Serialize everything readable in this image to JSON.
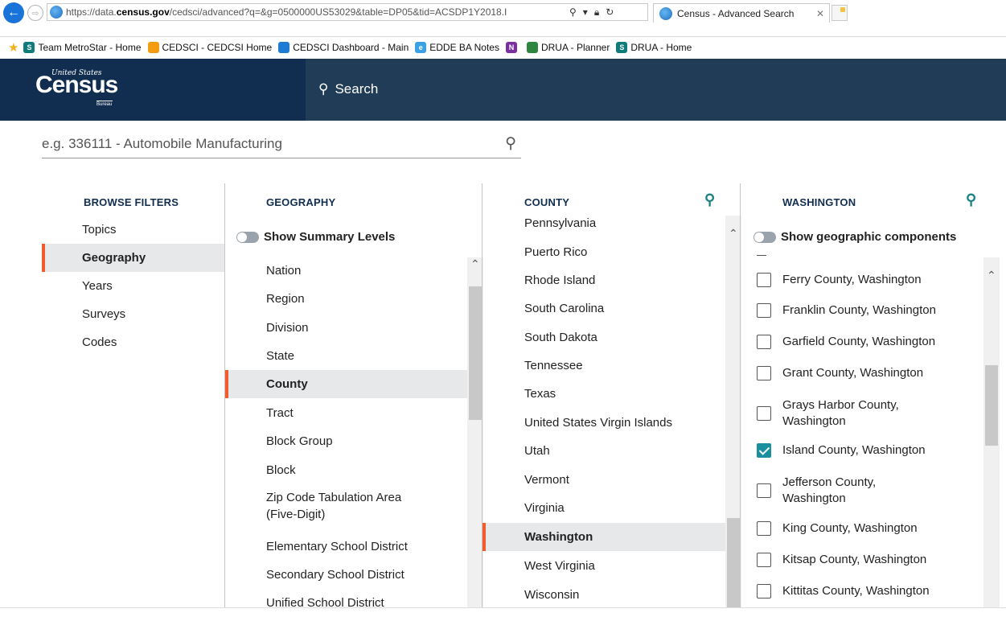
{
  "browser": {
    "url_plain_start": "https://data.",
    "url_bold": "census.gov",
    "url_rest": "/cedsci/advanced?q=&g=0500000US53029&table=DP05&tid=ACSDP1Y2018.I",
    "tab_title": "Census - Advanced Search",
    "favorites": [
      {
        "label": "Team MetroStar - Home",
        "icon": "sharepoint-icon"
      },
      {
        "label": "CEDSCI - CEDCSI Home",
        "icon": "cedsci-icon"
      },
      {
        "label": "CEDSCI Dashboard - Main",
        "icon": "dashboard-icon"
      },
      {
        "label": "EDDE BA Notes",
        "icon": "ie-icon"
      },
      {
        "label": "",
        "icon": "onenote-icon"
      },
      {
        "label": "DRUA - Planner",
        "icon": "planner-icon"
      },
      {
        "label": "DRUA - Home",
        "icon": "sharepoint-icon"
      }
    ]
  },
  "header": {
    "logo_small": "United States",
    "logo_big": "Census",
    "logo_sub": "Bureau",
    "search_label": "Search"
  },
  "search": {
    "placeholder": "e.g. 336111 - Automobile Manufacturing"
  },
  "browse": {
    "heading": "BROWSE FILTERS",
    "items": [
      "Topics",
      "Geography",
      "Years",
      "Surveys",
      "Codes"
    ],
    "active": "Geography"
  },
  "geography": {
    "heading": "GEOGRAPHY",
    "toggle_label": "Show Summary Levels",
    "items": [
      "Nation",
      "Region",
      "Division",
      "State",
      "County",
      "Tract",
      "Block Group",
      "Block",
      "Zip Code Tabulation Area (Five-Digit)",
      "Elementary School District",
      "Secondary School District",
      "Unified School District"
    ],
    "active": "County"
  },
  "county": {
    "heading": "COUNTY",
    "items": [
      "Pennsylvania",
      "Puerto Rico",
      "Rhode Island",
      "South Carolina",
      "South Dakota",
      "Tennessee",
      "Texas",
      "United States Virgin Islands",
      "Utah",
      "Vermont",
      "Virginia",
      "Washington",
      "West Virginia",
      "Wisconsin"
    ],
    "active": "Washington"
  },
  "washington": {
    "heading": "WASHINGTON",
    "toggle_label": "Show geographic components",
    "items": [
      {
        "label": "Ferry County, Washington",
        "checked": false
      },
      {
        "label": "Franklin County, Washington",
        "checked": false
      },
      {
        "label": "Garfield County, Washington",
        "checked": false
      },
      {
        "label": "Grant County, Washington",
        "checked": false
      },
      {
        "label": "Grays Harbor County, Washington",
        "checked": false
      },
      {
        "label": "Island County, Washington",
        "checked": true
      },
      {
        "label": "Jefferson County, Washington",
        "checked": false
      },
      {
        "label": "King County, Washington",
        "checked": false
      },
      {
        "label": "Kitsap County, Washington",
        "checked": false
      },
      {
        "label": "Kittitas County, Washington",
        "checked": false
      }
    ]
  },
  "colors": {
    "header_bg": "#213c56",
    "logo_bg": "#112e51",
    "accent": "#f25c2c",
    "teal": "#1a8fa0"
  }
}
